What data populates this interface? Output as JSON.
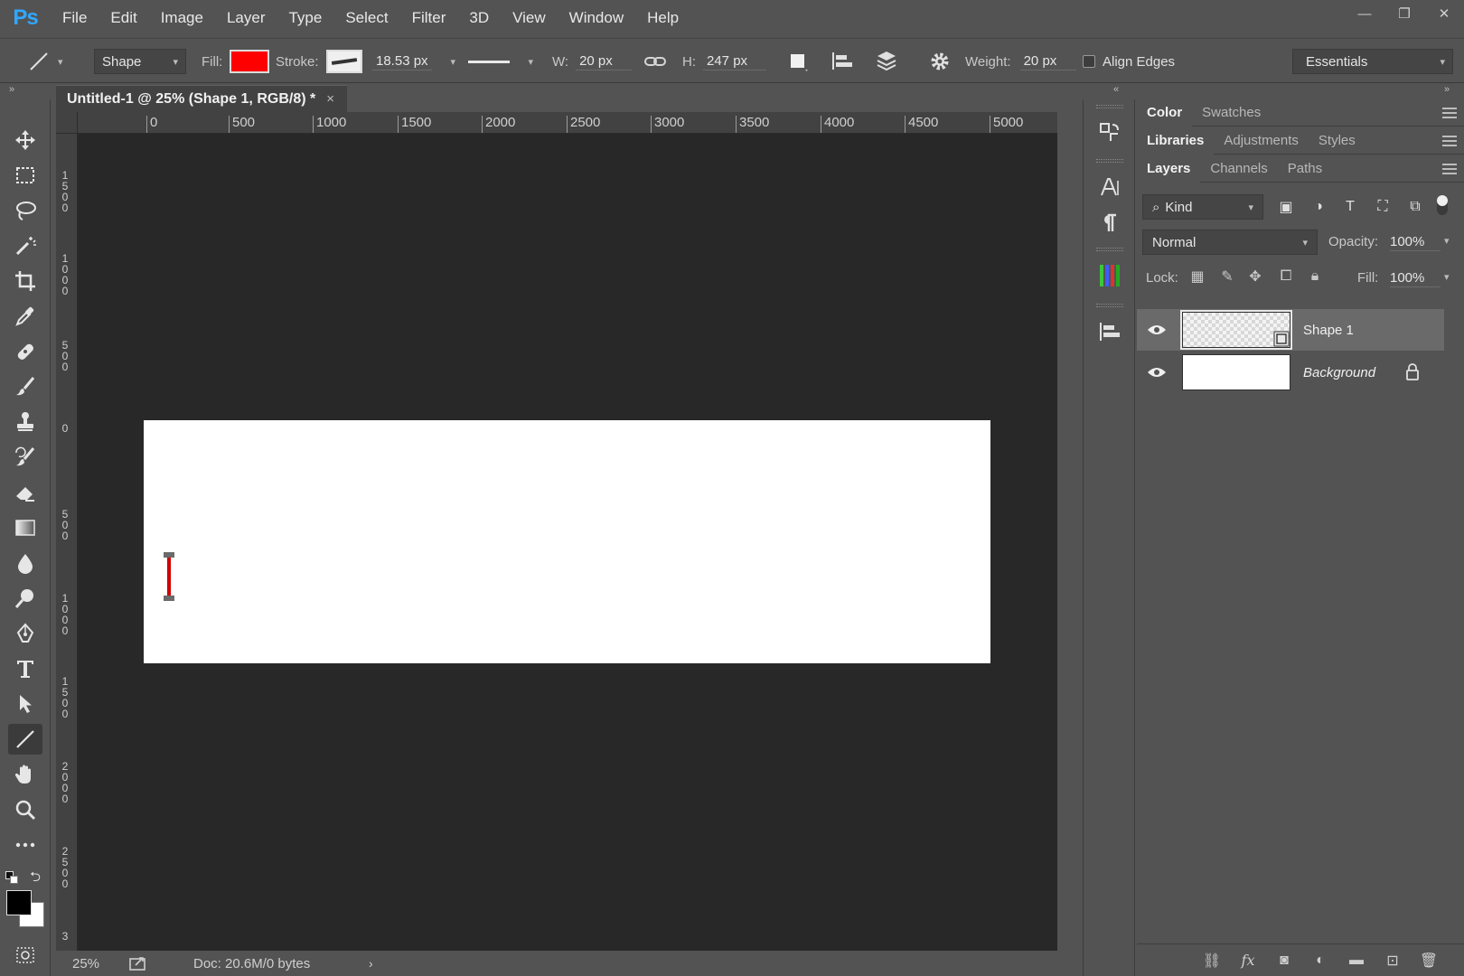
{
  "app": {
    "logo": "Ps"
  },
  "menu": [
    "File",
    "Edit",
    "Image",
    "Layer",
    "Type",
    "Select",
    "Filter",
    "3D",
    "View",
    "Window",
    "Help"
  ],
  "window_controls": {
    "minimize": "—",
    "restore": "❐",
    "close": "✕"
  },
  "options_bar": {
    "tool_mode": "Shape",
    "fill_label": "Fill:",
    "fill_color": "#ff0000",
    "stroke_label": "Stroke:",
    "stroke_width": "18.53 px",
    "w_label": "W:",
    "w_value": "20 px",
    "h_label": "H:",
    "h_value": "247 px",
    "weight_label": "Weight:",
    "weight_value": "20 px",
    "align_edges": "Align Edges",
    "align_edges_checked": false,
    "workspace": "Essentials"
  },
  "document": {
    "tab_title": "Untitled-1 @ 25% (Shape 1, RGB/8) *",
    "close": "×",
    "zoom": "25%",
    "doc_info": "Doc: 20.6M/0 bytes",
    "ruler_h": [
      "0",
      "500",
      "1000",
      "1500",
      "2000",
      "2500",
      "3000",
      "3500",
      "4000",
      "4500",
      "5000"
    ],
    "ruler_v": [
      "1500",
      "1000",
      "500",
      "0",
      "500",
      "1000",
      "1500",
      "2000",
      "2500",
      "3"
    ],
    "shape_color": "#d10000"
  },
  "panels": {
    "row1": [
      "Color",
      "Swatches"
    ],
    "row2": [
      "Libraries",
      "Adjustments",
      "Styles"
    ],
    "row3": [
      "Layers",
      "Channels",
      "Paths"
    ],
    "layers": {
      "kind": "Kind",
      "blend_mode": "Normal",
      "opacity_label": "Opacity:",
      "opacity": "100%",
      "lock_label": "Lock:",
      "fill_label": "Fill:",
      "fill": "100%",
      "items": [
        {
          "name": "Shape 1",
          "selected": true
        },
        {
          "name": "Background",
          "locked": true
        }
      ]
    }
  }
}
